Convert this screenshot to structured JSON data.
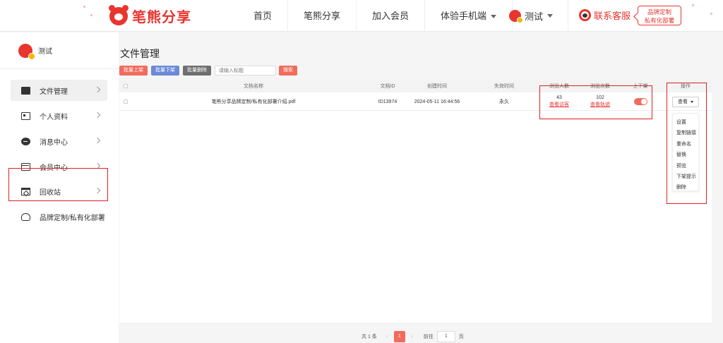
{
  "header": {
    "logo_text": "笔熊分享",
    "nav": [
      {
        "label": "首页"
      },
      {
        "label": "笔熊分享"
      },
      {
        "label": "加入会员"
      },
      {
        "label": "体验手机端"
      }
    ],
    "user_name": "测试",
    "support_label": "联系客服",
    "brand_line1": "品牌定制",
    "brand_line2": "私有化部署"
  },
  "sidebar": {
    "user_name": "测试",
    "items": [
      {
        "label": "文件管理"
      },
      {
        "label": "个人资料"
      },
      {
        "label": "消息中心"
      },
      {
        "label": "会员中心"
      },
      {
        "label": "回收站"
      },
      {
        "label": "品牌定制/私有化部署"
      }
    ]
  },
  "main": {
    "title": "文件管理",
    "toolbar": {
      "batch_up": "批量上架",
      "batch_down": "批量下架",
      "batch_delete": "批量删除",
      "search_placeholder": "请输入标题",
      "search_button": "搜索"
    },
    "columns": [
      "文档名称",
      "文档ID",
      "创建时间",
      "失效时间",
      "浏览人数",
      "浏览次数",
      "上下架",
      "操作"
    ],
    "rows": [
      {
        "name": "笔熊分享品牌定制/私有化部署介绍.pdf",
        "id": "ID13974",
        "created": "2024-05-11 16:44:56",
        "expires": "永久",
        "visitors": "43",
        "visitors_link": "查看访客",
        "views": "102",
        "views_link": "查看轨迹",
        "listed": true,
        "action_label": "查看"
      }
    ],
    "dropdown": [
      "设置",
      "复制链接",
      "重命名",
      "替换",
      "预览",
      "下架提示",
      "删除"
    ],
    "pagination": {
      "total": "共 1 条",
      "prev": "‹",
      "current": "1",
      "next": "›",
      "goto_label": "前往",
      "goto_value": "1",
      "page_suffix": "页"
    }
  },
  "colors": {
    "brand": "#e8352e",
    "accent": "#f36b5d",
    "blue_button": "#6c8ad8",
    "gray_button": "#6f6f6f",
    "highlight_box": "#e02020"
  }
}
